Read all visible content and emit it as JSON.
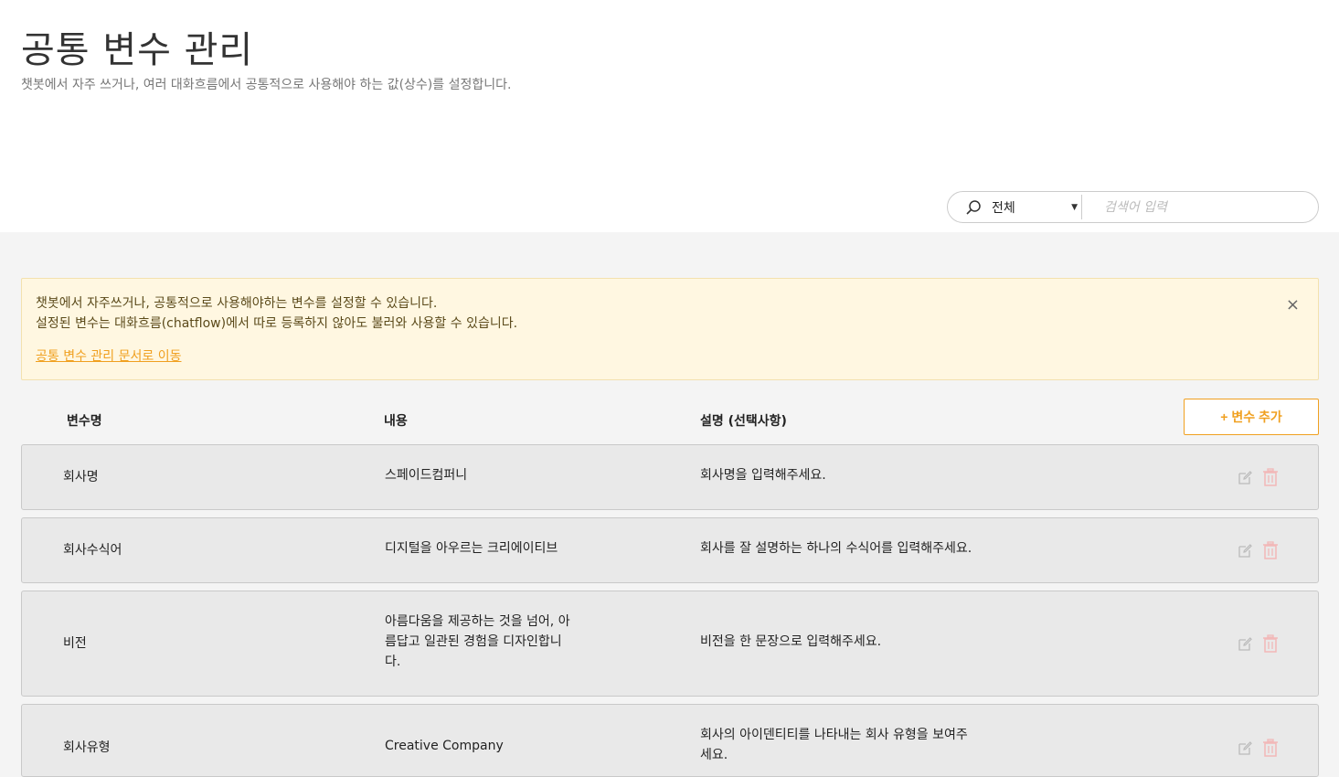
{
  "header": {
    "title": "공통 변수 관리",
    "description": "챗봇에서 자주 쓰거나, 여러 대화흐름에서 공통적으로 사용해야 하는 값(상수)를 설정합니다."
  },
  "search": {
    "filter_value": "전체",
    "placeholder": "검색어 입력"
  },
  "notice": {
    "line1": "챗봇에서 자주쓰거나, 공통적으로 사용해야하는 변수를 설정할 수 있습니다.",
    "line2": "설정된 변수는 대화흐름(chatflow)에서 따로 등록하지 않아도 불러와 사용할 수 있습니다.",
    "link": "공통 변수 관리 문서로 이동",
    "close": "×"
  },
  "table": {
    "columns": [
      "변수명",
      "내용",
      "설명 (선택사항)"
    ],
    "add_button": "+ 변수 추가",
    "rows": [
      {
        "name": "회사명",
        "content": "스페이드컴퍼니",
        "description": "회사명을 입력해주세요."
      },
      {
        "name": "회사수식어",
        "content": "디지털을 아우르는 크리에이티브",
        "description": "회사를 잘 설명하는 하나의 수식어를 입력해주세요."
      },
      {
        "name": "비전",
        "content": "아름다움을 제공하는 것을 넘어, 아름답고 일관된 경험을 디자인합니다.",
        "description": "비전을 한 문장으로 입력해주세요."
      },
      {
        "name": "회사유형",
        "content": "Creative Company",
        "description": "회사의 아이덴티티를 나타내는 회사 유형을 보여주세요."
      }
    ]
  },
  "icons": {
    "search": "search-icon",
    "edit": "edit-icon",
    "delete": "trash-icon",
    "close": "close-icon"
  },
  "colors": {
    "accent": "#f0a020",
    "notice_bg": "#fff7e1",
    "row_bg": "#e9e9e9",
    "trash": "#f2b8b8"
  }
}
